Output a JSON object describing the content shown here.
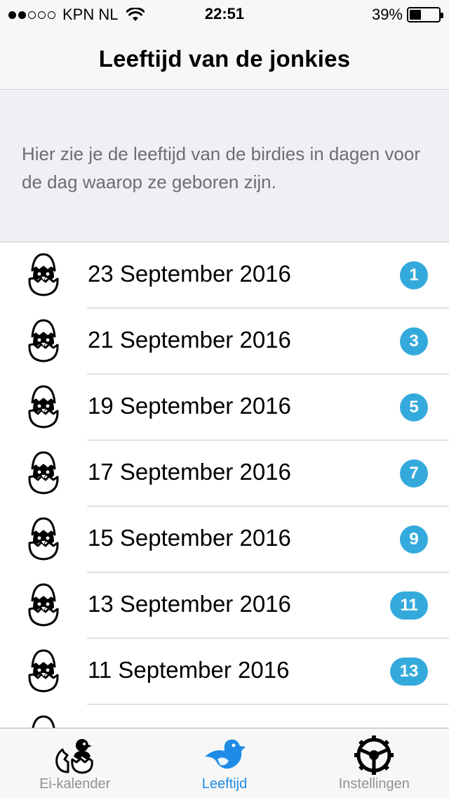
{
  "status_bar": {
    "carrier": "KPN NL",
    "time": "22:51",
    "battery_percent_label": "39%",
    "battery_level": 0.39,
    "signal_filled": 2,
    "signal_total": 5
  },
  "nav": {
    "title": "Leeftijd van de jonkies"
  },
  "info": {
    "text": "Hier zie je de leeftijd van de birdies in dagen voor de dag waarop ze geboren zijn."
  },
  "list": {
    "rows": [
      {
        "label": "23 September 2016",
        "badge": "1"
      },
      {
        "label": "21 September 2016",
        "badge": "3"
      },
      {
        "label": "19 September 2016",
        "badge": "5"
      },
      {
        "label": "17 September 2016",
        "badge": "7"
      },
      {
        "label": "15 September 2016",
        "badge": "9"
      },
      {
        "label": "13 September 2016",
        "badge": "11"
      },
      {
        "label": "11 September 2016",
        "badge": "13"
      },
      {
        "label": "",
        "badge": ""
      }
    ],
    "icon": "hatching-egg-icon"
  },
  "tabs": [
    {
      "label": "Ei-kalender",
      "icon": "egg-chick-icon",
      "active": false
    },
    {
      "label": "Leeftijd",
      "icon": "blue-bird-icon",
      "active": true
    },
    {
      "label": "Instellingen",
      "icon": "steering-wheel-icon",
      "active": false
    }
  ],
  "colors": {
    "accent": "#1e8ce6",
    "badge": "#34aadc",
    "header_bg": "#efeff4",
    "bar_bg": "#f7f7f7"
  }
}
